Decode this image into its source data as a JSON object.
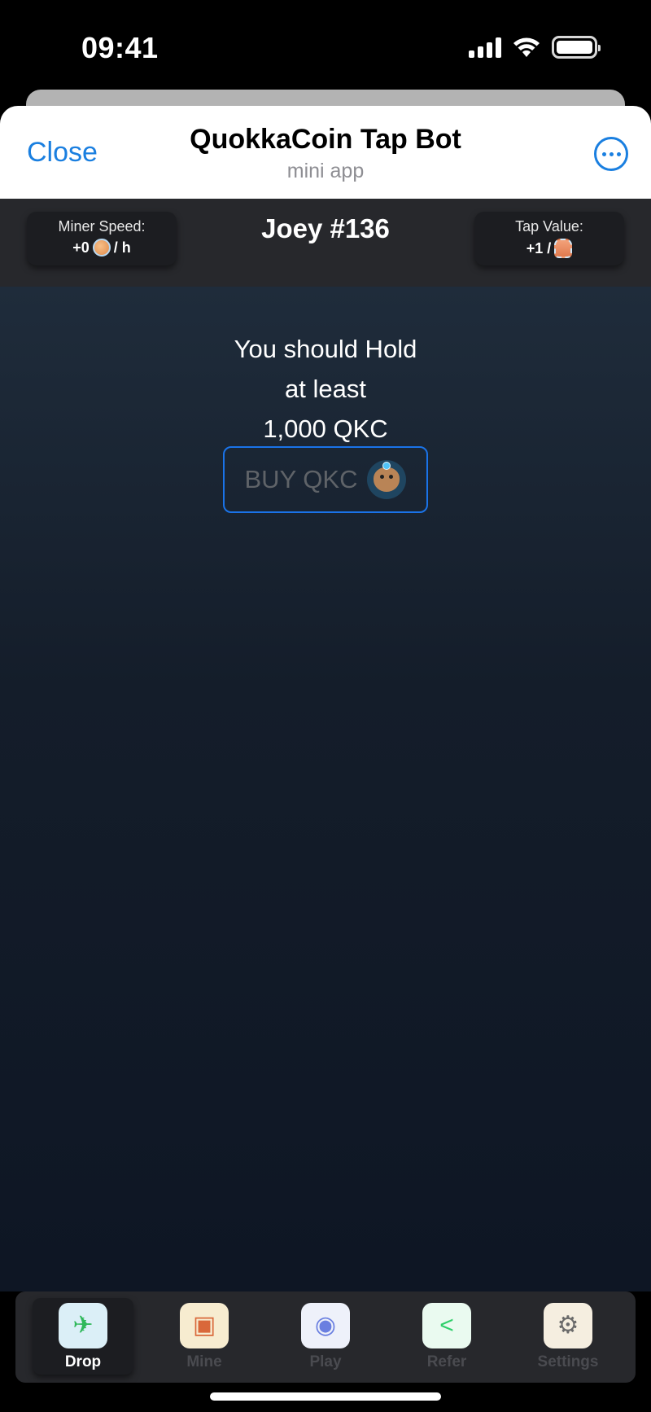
{
  "status_bar": {
    "time": "09:41"
  },
  "telegram_header": {
    "close_label": "Close",
    "title": "QuokkaCoin Tap Bot",
    "subtitle": "mini app"
  },
  "app_header": {
    "title": "Joey #136",
    "miner_speed": {
      "label": "Miner Speed:",
      "prefix": "+0",
      "suffix": "/ h"
    },
    "tap_value": {
      "label": "Tap Value:",
      "prefix": "+1 /"
    }
  },
  "main": {
    "hold_line1": "You should Hold",
    "hold_line2": "at least",
    "hold_line3": "1,000 QKC",
    "buy_label": "BUY QKC"
  },
  "nav": {
    "items": [
      {
        "label": "Drop",
        "icon": "helicopter-icon",
        "active": true
      },
      {
        "label": "Mine",
        "icon": "mine-cart-icon",
        "active": false
      },
      {
        "label": "Play",
        "icon": "gamepad-icon",
        "active": false
      },
      {
        "label": "Refer",
        "icon": "share-icon",
        "active": false
      },
      {
        "label": "Settings",
        "icon": "gear-icon",
        "active": false
      }
    ]
  },
  "colors": {
    "accent": "#1a7fe0",
    "top_bar": "#27282c",
    "card": "#1c1d21",
    "main_bg_top": "#1f2c3b",
    "main_bg_bottom": "#0e1624",
    "buy_border": "#1a73e8"
  }
}
